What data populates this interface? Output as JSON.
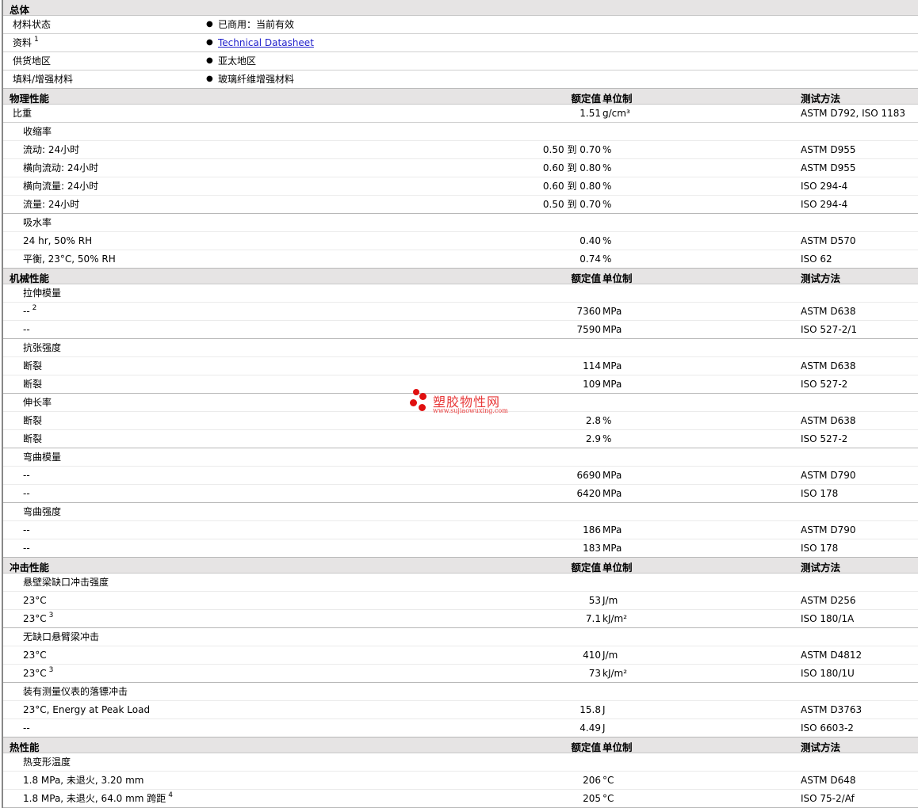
{
  "general": {
    "title": "总体",
    "rows": [
      {
        "label": "材料状态",
        "value": "已商用：当前有效"
      },
      {
        "label": "资料",
        "sup": "1",
        "value": "Technical Datasheet",
        "link": true
      },
      {
        "label": "供货地区",
        "value": "亚太地区"
      },
      {
        "label": "填料/增强材料",
        "value": "玻璃纤维增强材料"
      }
    ]
  },
  "columns": {
    "value": "额定值",
    "unit": "单位制",
    "method": "测试方法"
  },
  "sections": [
    {
      "title": "物理性能",
      "groups": [
        {
          "label": "比重",
          "value": "1.51",
          "unit": "g/cm³",
          "method": "ASTM D792, ISO 1183",
          "rows": []
        },
        {
          "label": "收缩率",
          "rows": [
            {
              "label": "流动: 24小时",
              "value": "0.50 到 0.70",
              "unit": "%",
              "method": "ASTM D955"
            },
            {
              "label": "横向流动: 24小时",
              "value": "0.60 到 0.80",
              "unit": "%",
              "method": "ASTM D955"
            },
            {
              "label": "横向流量: 24小时",
              "value": "0.60 到 0.80",
              "unit": "%",
              "method": "ISO 294-4"
            },
            {
              "label": "流量: 24小时",
              "value": "0.50 到 0.70",
              "unit": "%",
              "method": "ISO 294-4"
            }
          ]
        },
        {
          "label": "吸水率",
          "rows": [
            {
              "label": "24 hr, 50% RH",
              "value": "0.40",
              "unit": "%",
              "method": "ASTM D570"
            },
            {
              "label": "平衡, 23°C, 50% RH",
              "value": "0.74",
              "unit": "%",
              "method": "ISO 62"
            }
          ]
        }
      ]
    },
    {
      "title": "机械性能",
      "groups": [
        {
          "label": "拉伸模量",
          "rows": [
            {
              "label": "--",
              "sup": "2",
              "value": "7360",
              "unit": "MPa",
              "method": "ASTM D638"
            },
            {
              "label": "--",
              "value": "7590",
              "unit": "MPa",
              "method": "ISO 527-2/1"
            }
          ]
        },
        {
          "label": "抗张强度",
          "rows": [
            {
              "label": "断裂",
              "value": "114",
              "unit": "MPa",
              "method": "ASTM D638"
            },
            {
              "label": "断裂",
              "value": "109",
              "unit": "MPa",
              "method": "ISO 527-2"
            }
          ]
        },
        {
          "label": "伸长率",
          "rows": [
            {
              "label": "断裂",
              "value": "2.8",
              "unit": "%",
              "method": "ASTM D638"
            },
            {
              "label": "断裂",
              "value": "2.9",
              "unit": "%",
              "method": "ISO 527-2"
            }
          ]
        },
        {
          "label": "弯曲模量",
          "rows": [
            {
              "label": "--",
              "value": "6690",
              "unit": "MPa",
              "method": "ASTM D790"
            },
            {
              "label": "--",
              "value": "6420",
              "unit": "MPa",
              "method": "ISO 178"
            }
          ]
        },
        {
          "label": "弯曲强度",
          "rows": [
            {
              "label": "--",
              "value": "186",
              "unit": "MPa",
              "method": "ASTM D790"
            },
            {
              "label": "--",
              "value": "183",
              "unit": "MPa",
              "method": "ISO 178"
            }
          ]
        }
      ]
    },
    {
      "title": "冲击性能",
      "groups": [
        {
          "label": "悬壁梁缺口冲击强度",
          "rows": [
            {
              "label": "23°C",
              "value": "53",
              "unit": "J/m",
              "method": "ASTM D256"
            },
            {
              "label": "23°C",
              "sup": "3",
              "value": "7.1",
              "unit": "kJ/m²",
              "method": "ISO 180/1A"
            }
          ]
        },
        {
          "label": "无缺口悬臂梁冲击",
          "rows": [
            {
              "label": "23°C",
              "value": "410",
              "unit": "J/m",
              "method": "ASTM D4812"
            },
            {
              "label": "23°C",
              "sup": "3",
              "value": "73",
              "unit": "kJ/m²",
              "method": "ISO 180/1U"
            }
          ]
        },
        {
          "label": "装有测量仪表的落镖冲击",
          "rows": [
            {
              "label": "23°C, Energy at Peak Load",
              "value": "15.8",
              "unit": "J",
              "method": "ASTM D3763"
            },
            {
              "label": "--",
              "value": "4.49",
              "unit": "J",
              "method": "ISO 6603-2"
            }
          ]
        }
      ]
    },
    {
      "title": "热性能",
      "groups": [
        {
          "label": "热变形温度",
          "rows": [
            {
              "label": "1.8 MPa, 未退火, 3.20 mm",
              "value": "206",
              "unit": "°C",
              "method": "ASTM D648"
            },
            {
              "label": "1.8 MPa, 未退火, 64.0 mm 跨距",
              "sup": "4",
              "value": "205",
              "unit": "°C",
              "method": "ISO 75-2/Af"
            }
          ]
        }
      ]
    }
  ],
  "watermark": {
    "name": "塑胶物性网",
    "url": "www.sujiaowuxing.com"
  }
}
